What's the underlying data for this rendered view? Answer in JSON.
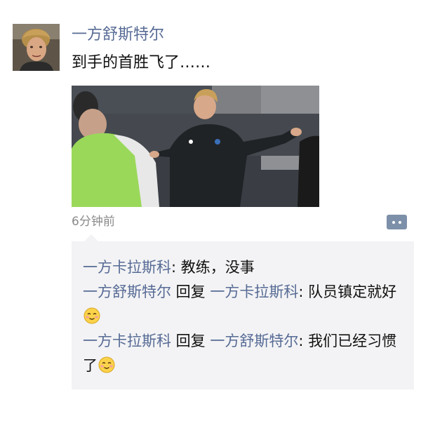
{
  "post": {
    "author": "一方舒斯特尔",
    "text": "到手的首胜飞了……",
    "timestamp": "6分钟前"
  },
  "icons": {
    "avatar": "avatar-photo",
    "photo": "coach-training-photo",
    "more": "more-dots-icon",
    "emoji": "smile-emoji-icon"
  },
  "comments": [
    {
      "author": "一方卡拉斯科",
      "separator": ": ",
      "text": "教练，没事"
    },
    {
      "author": "一方舒斯特尔",
      "reply_word": " 回复 ",
      "reply_to": "一方卡拉斯科",
      "separator": ": ",
      "text": "队员镇定就好"
    },
    {
      "author": "一方卡拉斯科",
      "reply_word": " 回复 ",
      "reply_to": "一方舒斯特尔",
      "separator": ": ",
      "text": "我们已经习惯了"
    }
  ],
  "colors": {
    "name_link": "#576b95",
    "comment_bg": "#f3f3f5",
    "more_button": "#7d90a9"
  }
}
